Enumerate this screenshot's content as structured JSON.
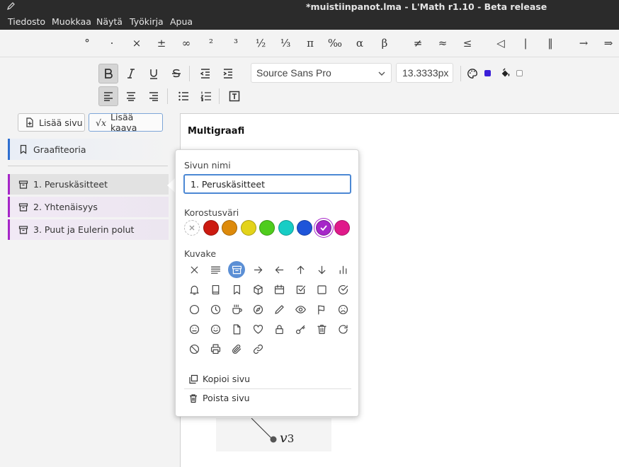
{
  "window": {
    "title": "*muistiinpanot.lma - L'Math r1.10 - Beta release"
  },
  "menu": [
    "Tiedosto",
    "Muokkaa",
    "Näytä",
    "Työkirja",
    "Apua"
  ],
  "symbols": [
    "°",
    "·",
    "×",
    "±",
    "∞",
    "²",
    "³",
    "½",
    "⅓",
    "π",
    "‰",
    "α",
    "β",
    "≠",
    "≈",
    "≤",
    "◁",
    "|",
    "‖",
    "→",
    "⇒"
  ],
  "format": {
    "font_family": "Source Sans Pro",
    "font_size": "13.3333px",
    "text_color": "#3b1fd8",
    "fill_color": "#ffffff"
  },
  "sidebar": {
    "add_page": "Lisää sivu",
    "add_formula": "Lisää kaava",
    "formula_icon_text": "√x",
    "pages": [
      {
        "label": "Graafiteoria",
        "icon": "bookmark-icon"
      },
      {
        "label": "1. Peruskäsitteet",
        "icon": "archive-icon"
      },
      {
        "label": "2. Yhtenäisyys",
        "icon": "archive-icon"
      },
      {
        "label": "3. Puut ja Eulerin polut",
        "icon": "archive-icon"
      }
    ]
  },
  "canvas": {
    "page_title": "Multigraafi",
    "vertex_label": "v",
    "vertex_subscript": "3"
  },
  "popup": {
    "name_label": "Sivun nimi",
    "name_value": "1. Peruskäsitteet",
    "color_label": "Korostusväri",
    "colors": [
      "none",
      "#cc1a10",
      "#dd8a0a",
      "#e3d31a",
      "#4fcc1d",
      "#17cdc5",
      "#1f55d9",
      "#a626c8",
      "#e0198a"
    ],
    "selected_color": "#a626c8",
    "icon_label": "Kuvake",
    "icons": [
      "close-icon",
      "align-justify-icon",
      "archive-icon",
      "arrow-right-icon",
      "arrow-left-icon",
      "arrow-up-icon",
      "arrow-down-icon",
      "bar-chart-icon",
      "bell-icon",
      "book-icon",
      "bookmark-icon",
      "box-icon",
      "calendar-icon",
      "check-square-icon",
      "square-icon",
      "check-circle-icon",
      "circle-icon",
      "clock-icon",
      "coffee-icon",
      "compass-icon",
      "pencil-icon",
      "eye-icon",
      "flag-icon",
      "frown-icon",
      "meh-icon",
      "smile-icon",
      "file-icon",
      "heart-icon",
      "lock-icon",
      "key-icon",
      "trash-icon",
      "refresh-icon",
      "slash-icon",
      "printer-icon",
      "paperclip-icon",
      "link-icon"
    ],
    "selected_icon": "archive-icon",
    "copy_page": "Kopioi sivu",
    "delete_page": "Poista sivu"
  }
}
